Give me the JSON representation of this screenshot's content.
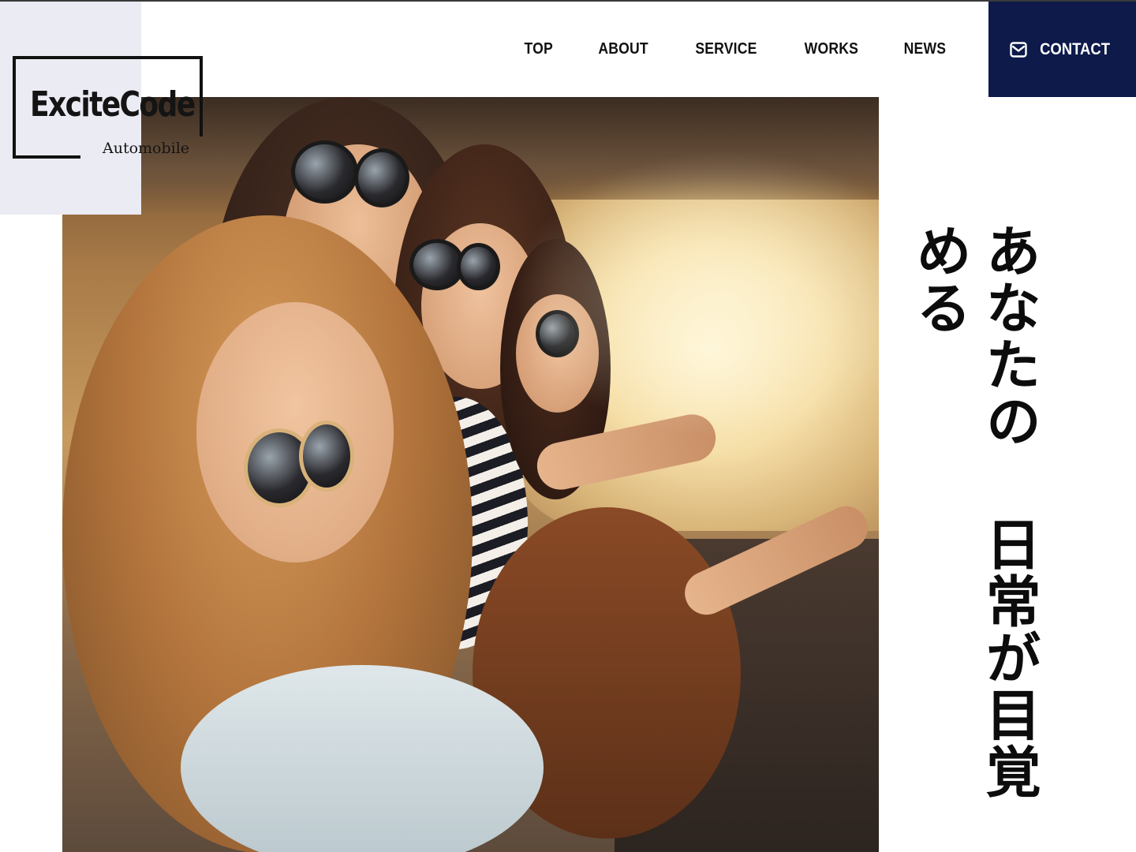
{
  "logo": {
    "name": "ExciteCode",
    "subtitle": "Automobile"
  },
  "nav": {
    "items": [
      {
        "label": "TOP"
      },
      {
        "label": "ABOUT"
      },
      {
        "label": "SERVICE"
      },
      {
        "label": "WORKS"
      },
      {
        "label": "NEWS"
      }
    ],
    "contact": {
      "label": "CONTACT",
      "icon": "mail-icon",
      "background": "#0d1a4a"
    }
  },
  "hero": {
    "image": "four-women-in-car-sunglasses-photo",
    "tagline": {
      "line1": "あなたの",
      "line2": "日常が目覚める"
    }
  },
  "colors": {
    "logo_panel": "#ebebf3",
    "accent": "#0d1a4a",
    "text": "#111111"
  }
}
